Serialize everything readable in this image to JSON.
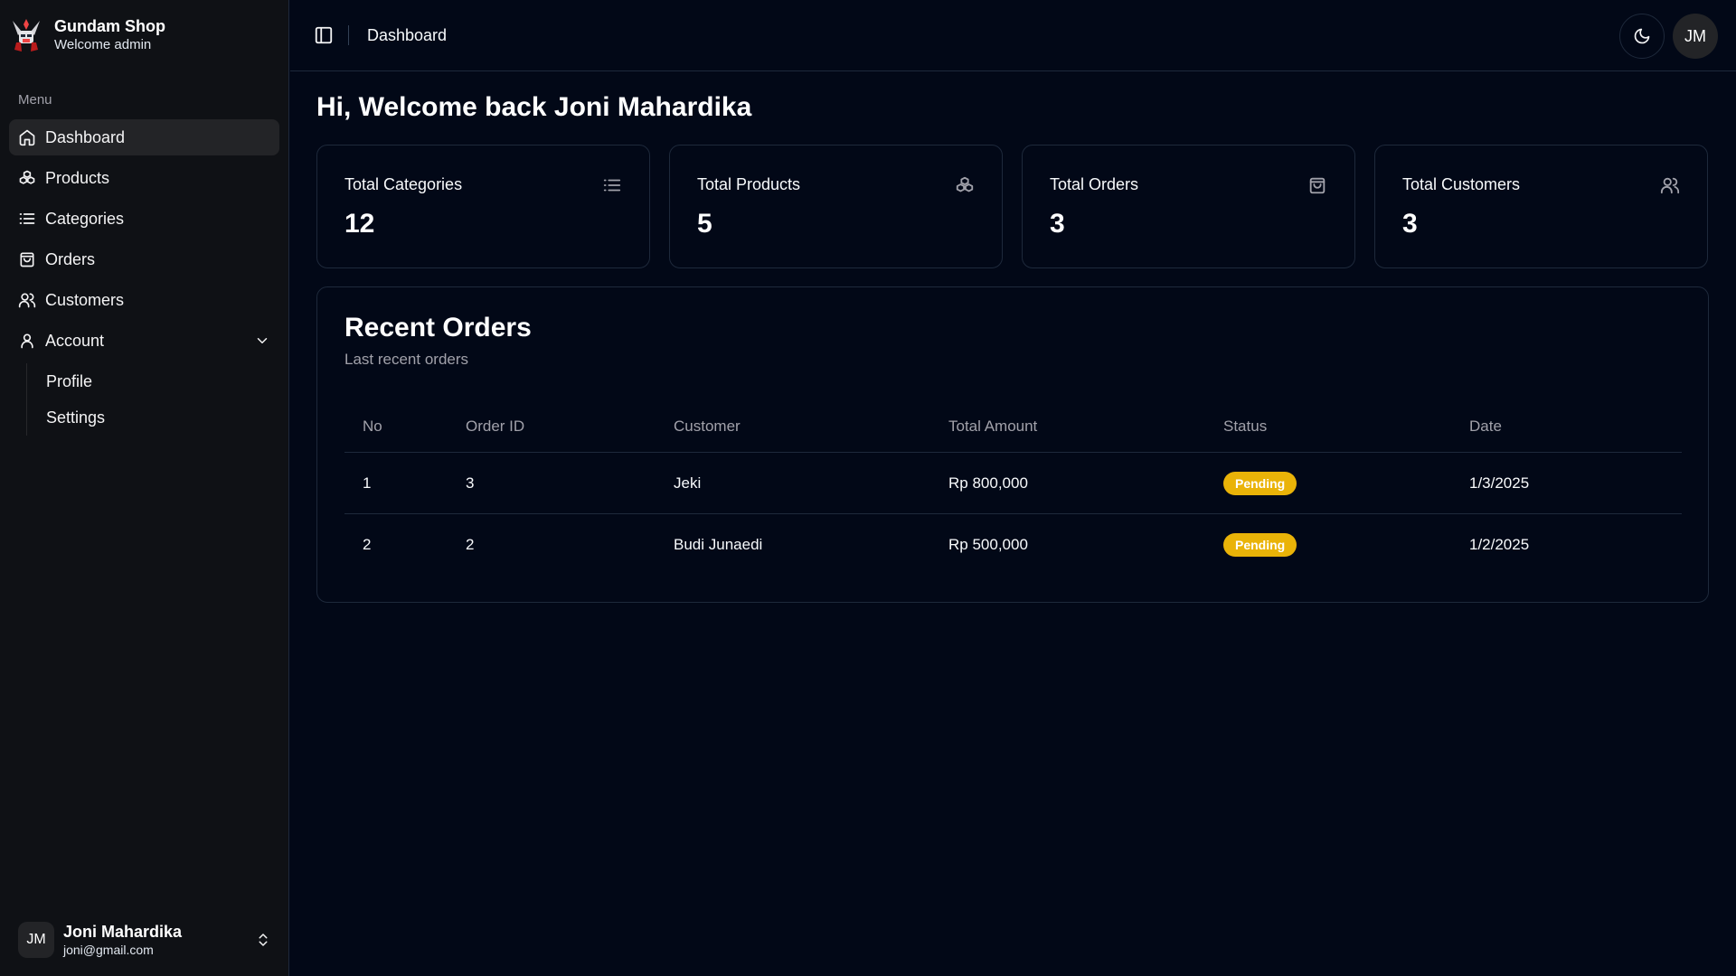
{
  "brand": {
    "name": "Gundam Shop",
    "subtitle": "Welcome admin"
  },
  "sidebar": {
    "menu_label": "Menu",
    "items": [
      {
        "label": "Dashboard",
        "icon": "home-icon",
        "active": true
      },
      {
        "label": "Products",
        "icon": "boxes-icon"
      },
      {
        "label": "Categories",
        "icon": "list-icon"
      },
      {
        "label": "Orders",
        "icon": "shopping-bag-icon"
      },
      {
        "label": "Customers",
        "icon": "users-icon"
      },
      {
        "label": "Account",
        "icon": "user-icon",
        "expanded": true
      }
    ],
    "account_subitems": [
      {
        "label": "Profile"
      },
      {
        "label": "Settings"
      }
    ]
  },
  "user": {
    "initials": "JM",
    "name": "Joni Mahardika",
    "email": "joni@gmail.com"
  },
  "header": {
    "title": "Dashboard",
    "avatar_initials": "JM"
  },
  "main": {
    "welcome": "Hi, Welcome back Joni Mahardika",
    "stats": [
      {
        "title": "Total Categories",
        "value": "12",
        "icon": "list-icon"
      },
      {
        "title": "Total Products",
        "value": "5",
        "icon": "boxes-icon"
      },
      {
        "title": "Total Orders",
        "value": "3",
        "icon": "shopping-bag-icon"
      },
      {
        "title": "Total Customers",
        "value": "3",
        "icon": "users-icon"
      }
    ],
    "recent_orders": {
      "title": "Recent Orders",
      "subtitle": "Last recent orders",
      "columns": [
        "No",
        "Order ID",
        "Customer",
        "Total Amount",
        "Status",
        "Date"
      ],
      "rows": [
        {
          "no": "1",
          "order_id": "3",
          "customer": "Jeki",
          "amount": "Rp 800,000",
          "status": "Pending",
          "date": "1/3/2025"
        },
        {
          "no": "2",
          "order_id": "2",
          "customer": "Budi Junaedi",
          "amount": "Rp 500,000",
          "status": "Pending",
          "date": "1/2/2025"
        }
      ]
    }
  },
  "colors": {
    "background": "#020817",
    "sidebar": "#0f1115",
    "pending_badge": "#eab308"
  }
}
